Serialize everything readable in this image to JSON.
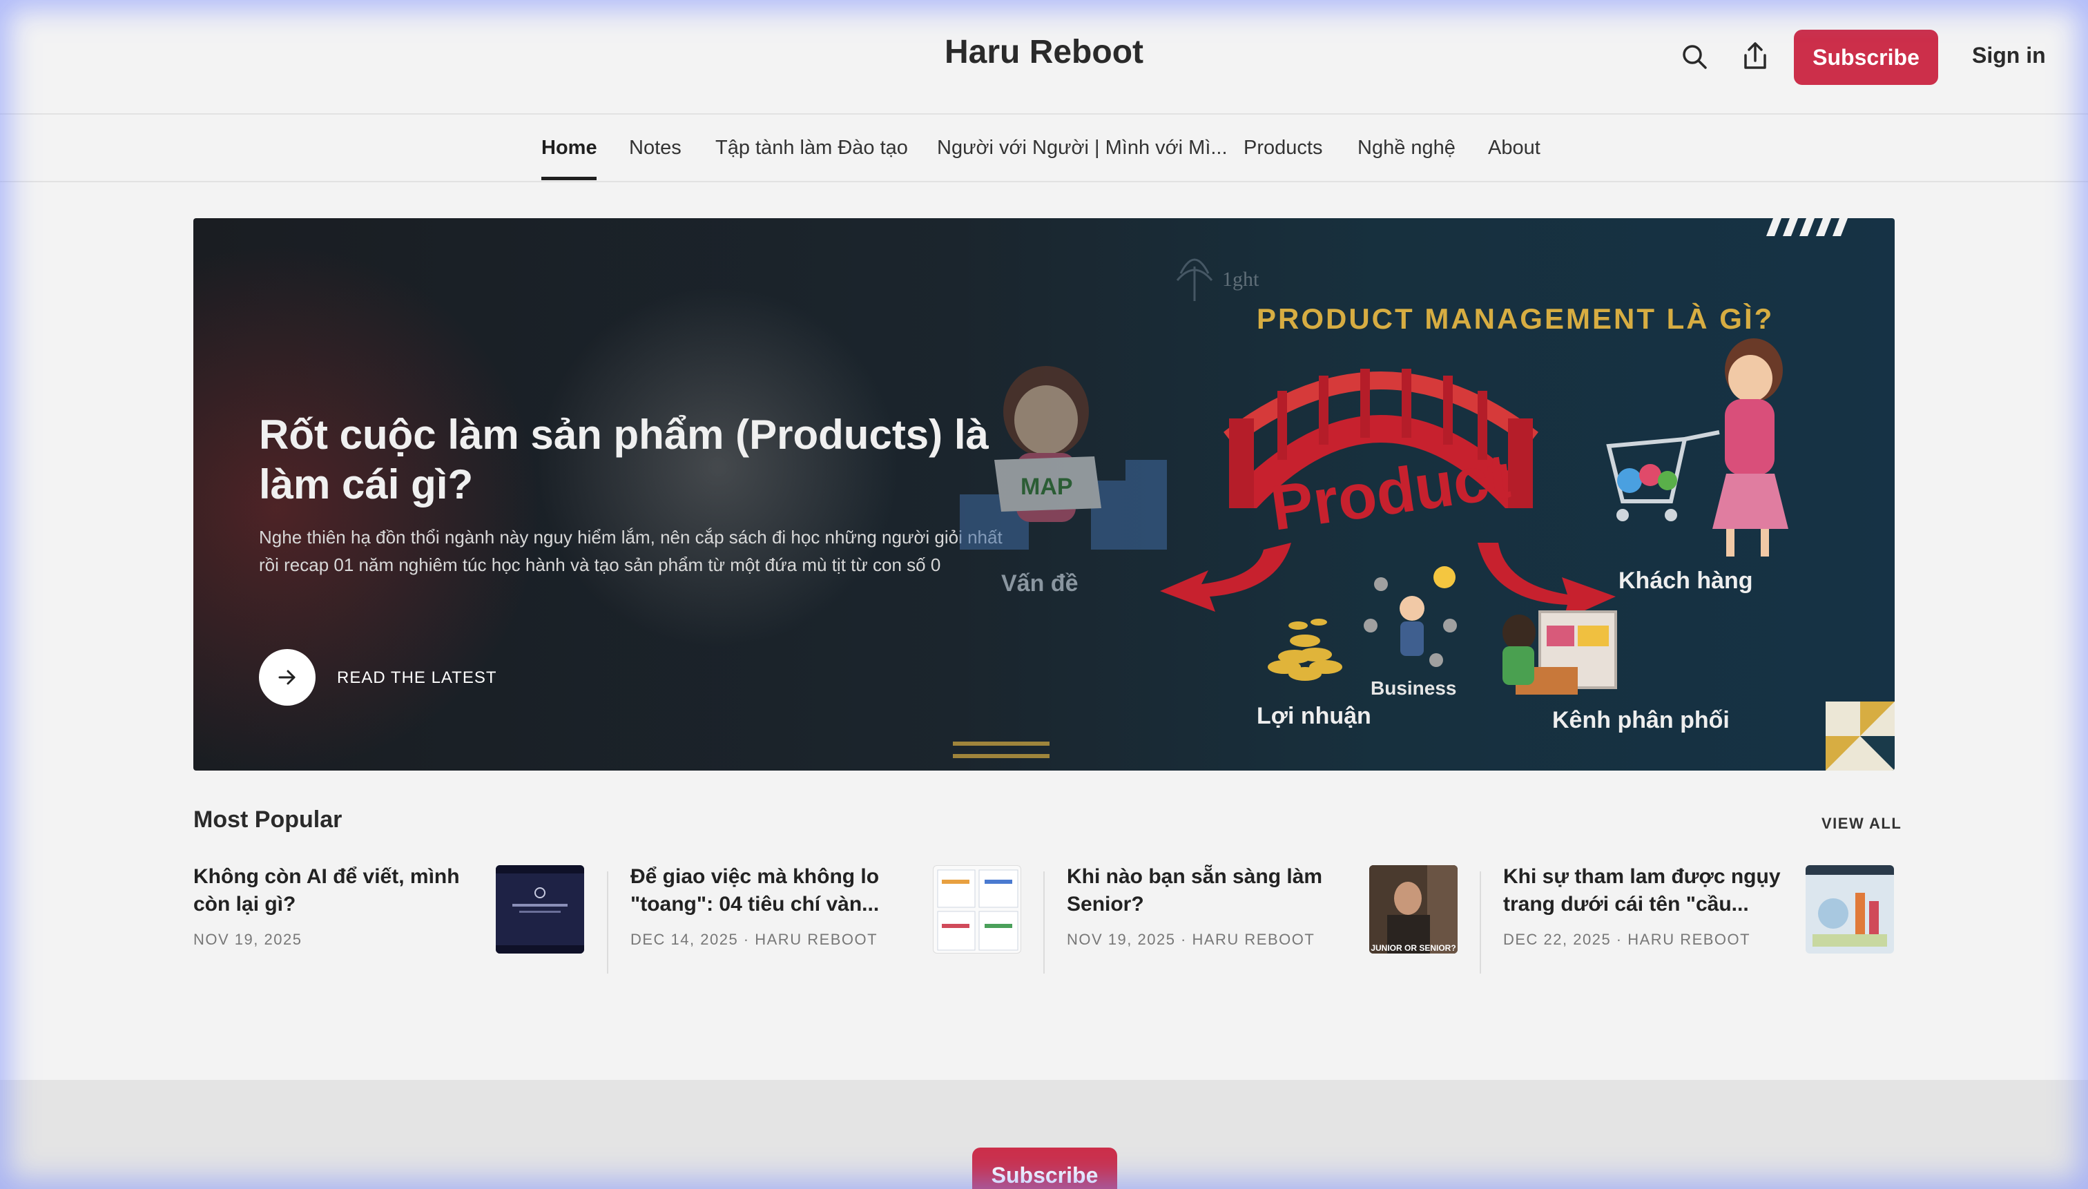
{
  "header": {
    "site_title": "Haru Reboot",
    "subscribe_label": "Subscribe",
    "signin_label": "Sign in"
  },
  "nav": {
    "items": [
      {
        "label": "Home",
        "active": true
      },
      {
        "label": "Notes"
      },
      {
        "label": "Tập tành làm Đào tạo"
      },
      {
        "label": "Người với Người | Mình với Mì..."
      },
      {
        "label": "Products"
      },
      {
        "label": "Nghề nghệ"
      },
      {
        "label": "About"
      }
    ]
  },
  "hero": {
    "title": "Rốt cuộc làm sản phẩm (Products) là làm cái gì?",
    "description": "Nghe thiên hạ đồn thổi ngành này nguy hiểm lắm, nên cắp sách đi học những người giỏi nhất rồi recap 01 năm nghiêm túc học hành và tạo sản phẩm từ một đứa mù tịt từ con số 0",
    "cta_label": "READ THE LATEST",
    "art": {
      "heading": "PRODUCT MANAGEMENT LÀ GÌ?",
      "logo_text": "1ght",
      "map_text": "MAP",
      "product_word": "Product",
      "labels": {
        "problem": "Vấn đề",
        "customer": "Khách hàng",
        "business": "Business",
        "profit": "Lợi nhuận",
        "channel": "Kênh phân phối"
      }
    }
  },
  "popular": {
    "heading": "Most Popular",
    "view_all": "VIEW ALL",
    "posts": [
      {
        "title": "Không còn AI để viết, mình còn lại gì?",
        "meta": "NOV 19, 2025"
      },
      {
        "title": "Để giao việc mà không lo \"toang\": 04 tiêu chí vàn...",
        "meta": "DEC 14, 2025 · HARU REBOOT"
      },
      {
        "title": "Khi nào bạn sẵn sàng làm Senior?",
        "meta": "NOV 19, 2025 · HARU REBOOT",
        "thumb_caption": "JUNIOR OR SENIOR?"
      },
      {
        "title": "Khi sự tham lam được ngụy trang dưới cái tên \"cầu...",
        "meta": "DEC 22, 2025 · HARU REBOOT"
      }
    ]
  },
  "footer": {
    "subscribe_label": "Subscribe"
  },
  "colors": {
    "accent": "#cc2f4a",
    "hero_gold": "#d7ad42",
    "bridge_red": "#c7212e"
  }
}
